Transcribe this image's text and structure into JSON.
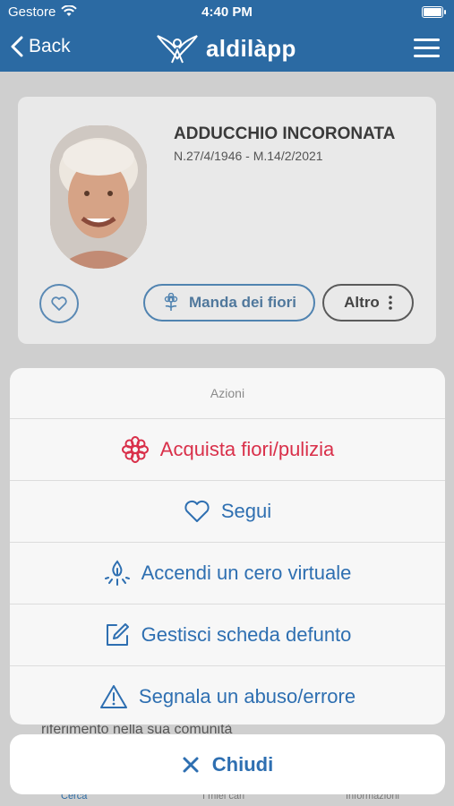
{
  "status_bar": {
    "carrier": "Gestore",
    "time": "4:40 PM"
  },
  "nav": {
    "back_label": "Back",
    "logo_text": "aldilàpp"
  },
  "card": {
    "name": "ADDUCCHIO INCORONATA",
    "dates": "N.27/4/1946 - M.14/2/2021",
    "send_flowers_label": "Manda dei fiori",
    "more_label": "Altro"
  },
  "background_text": "riferimento nella sua comunità",
  "tabs": [
    {
      "label": "Cerca"
    },
    {
      "label": "I miei cari"
    },
    {
      "label": "Informazioni"
    }
  ],
  "action_sheet": {
    "title": "Azioni",
    "items": [
      {
        "label": "Acquista fiori/pulizia",
        "icon": "flower-icon",
        "color": "#d9304a"
      },
      {
        "label": "Segui",
        "icon": "heart-icon",
        "color": "#2e6fb1"
      },
      {
        "label": "Accendi un cero virtuale",
        "icon": "candle-icon",
        "color": "#2e6fb1"
      },
      {
        "label": "Gestisci scheda defunto",
        "icon": "edit-icon",
        "color": "#2e6fb1"
      },
      {
        "label": "Segnala un abuso/errore",
        "icon": "warning-icon",
        "color": "#2e6fb1"
      }
    ],
    "cancel_label": "Chiudi"
  },
  "colors": {
    "brand": "#2b6aa3",
    "action": "#2e6fb1",
    "destructive": "#d9304a"
  }
}
